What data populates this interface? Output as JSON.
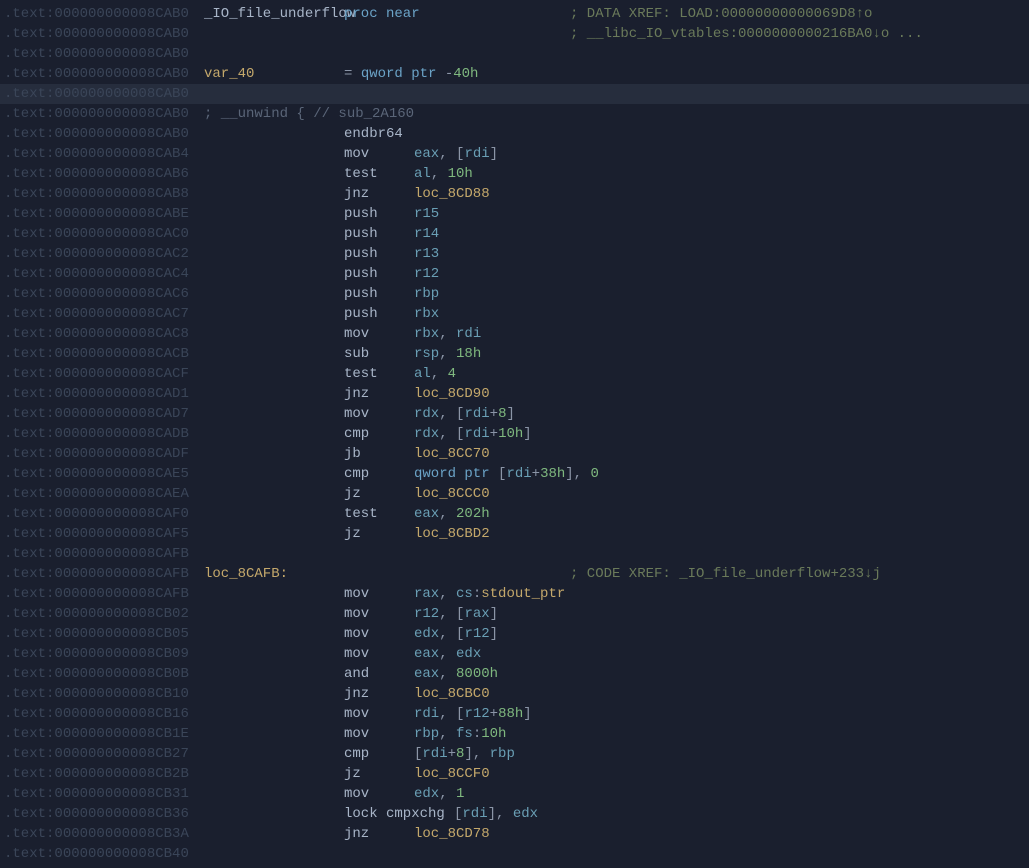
{
  "segment": ".text:",
  "lines": [
    {
      "addr": "000000000008CAB0",
      "label": "_IO_file_underflow",
      "label_class": "c-identifier",
      "directive": "proc near",
      "comment": "; DATA XREF: LOAD:00000000000069D8↑o",
      "comment_col": 570
    },
    {
      "addr": "000000000008CAB0",
      "comment": "; __libc_IO_vtables:0000000000216BA0↓o ...",
      "comment_col": 570
    },
    {
      "addr": "000000000008CAB0"
    },
    {
      "addr": "000000000008CAB0",
      "label": "var_40",
      "label_class": "c-loc",
      "var_eq": "= qword ptr -40h"
    },
    {
      "addr": "000000000008CAB0",
      "cursor": true
    },
    {
      "addr": "000000000008CAB0",
      "unwind": "; __unwind { // sub_2A160"
    },
    {
      "addr": "000000000008CAB0",
      "mnem": "endbr64"
    },
    {
      "addr": "000000000008CAB4",
      "mnem": "mov",
      "ops": [
        {
          "t": "eax",
          "c": "c-reg"
        },
        {
          "t": ", ",
          "c": "c-op"
        },
        {
          "t": "[",
          "c": "c-op"
        },
        {
          "t": "rdi",
          "c": "c-reg"
        },
        {
          "t": "]",
          "c": "c-op"
        }
      ]
    },
    {
      "addr": "000000000008CAB6",
      "mnem": "test",
      "ops": [
        {
          "t": "al",
          "c": "c-reg"
        },
        {
          "t": ", ",
          "c": "c-op"
        },
        {
          "t": "10h",
          "c": "c-num"
        }
      ]
    },
    {
      "addr": "000000000008CAB8",
      "mnem": "jnz",
      "ops": [
        {
          "t": "loc_8CD88",
          "c": "c-loc"
        }
      ]
    },
    {
      "addr": "000000000008CABE",
      "mnem": "push",
      "ops": [
        {
          "t": "r15",
          "c": "c-reg"
        }
      ]
    },
    {
      "addr": "000000000008CAC0",
      "mnem": "push",
      "ops": [
        {
          "t": "r14",
          "c": "c-reg"
        }
      ]
    },
    {
      "addr": "000000000008CAC2",
      "mnem": "push",
      "ops": [
        {
          "t": "r13",
          "c": "c-reg"
        }
      ]
    },
    {
      "addr": "000000000008CAC4",
      "mnem": "push",
      "ops": [
        {
          "t": "r12",
          "c": "c-reg"
        }
      ]
    },
    {
      "addr": "000000000008CAC6",
      "mnem": "push",
      "ops": [
        {
          "t": "rbp",
          "c": "c-reg"
        }
      ]
    },
    {
      "addr": "000000000008CAC7",
      "mnem": "push",
      "ops": [
        {
          "t": "rbx",
          "c": "c-reg"
        }
      ]
    },
    {
      "addr": "000000000008CAC8",
      "mnem": "mov",
      "ops": [
        {
          "t": "rbx",
          "c": "c-reg"
        },
        {
          "t": ", ",
          "c": "c-op"
        },
        {
          "t": "rdi",
          "c": "c-reg"
        }
      ]
    },
    {
      "addr": "000000000008CACB",
      "mnem": "sub",
      "ops": [
        {
          "t": "rsp",
          "c": "c-reg"
        },
        {
          "t": ", ",
          "c": "c-op"
        },
        {
          "t": "18h",
          "c": "c-num"
        }
      ]
    },
    {
      "addr": "000000000008CACF",
      "mnem": "test",
      "ops": [
        {
          "t": "al",
          "c": "c-reg"
        },
        {
          "t": ", ",
          "c": "c-op"
        },
        {
          "t": "4",
          "c": "c-num"
        }
      ]
    },
    {
      "addr": "000000000008CAD1",
      "mnem": "jnz",
      "ops": [
        {
          "t": "loc_8CD90",
          "c": "c-loc"
        }
      ]
    },
    {
      "addr": "000000000008CAD7",
      "mnem": "mov",
      "ops": [
        {
          "t": "rdx",
          "c": "c-reg"
        },
        {
          "t": ", ",
          "c": "c-op"
        },
        {
          "t": "[",
          "c": "c-op"
        },
        {
          "t": "rdi",
          "c": "c-reg"
        },
        {
          "t": "+",
          "c": "c-op"
        },
        {
          "t": "8",
          "c": "c-num"
        },
        {
          "t": "]",
          "c": "c-op"
        }
      ]
    },
    {
      "addr": "000000000008CADB",
      "mnem": "cmp",
      "ops": [
        {
          "t": "rdx",
          "c": "c-reg"
        },
        {
          "t": ", ",
          "c": "c-op"
        },
        {
          "t": "[",
          "c": "c-op"
        },
        {
          "t": "rdi",
          "c": "c-reg"
        },
        {
          "t": "+",
          "c": "c-op"
        },
        {
          "t": "10h",
          "c": "c-num"
        },
        {
          "t": "]",
          "c": "c-op"
        }
      ]
    },
    {
      "addr": "000000000008CADF",
      "mnem": "jb",
      "ops": [
        {
          "t": "loc_8CC70",
          "c": "c-loc"
        }
      ]
    },
    {
      "addr": "000000000008CAE5",
      "mnem": "cmp",
      "ops": [
        {
          "t": "qword ptr",
          "c": "c-type"
        },
        {
          "t": " [",
          "c": "c-op"
        },
        {
          "t": "rdi",
          "c": "c-reg"
        },
        {
          "t": "+",
          "c": "c-op"
        },
        {
          "t": "38h",
          "c": "c-num"
        },
        {
          "t": "], ",
          "c": "c-op"
        },
        {
          "t": "0",
          "c": "c-num"
        }
      ]
    },
    {
      "addr": "000000000008CAEA",
      "mnem": "jz",
      "ops": [
        {
          "t": "loc_8CCC0",
          "c": "c-loc"
        }
      ]
    },
    {
      "addr": "000000000008CAF0",
      "mnem": "test",
      "ops": [
        {
          "t": "eax",
          "c": "c-reg"
        },
        {
          "t": ", ",
          "c": "c-op"
        },
        {
          "t": "202h",
          "c": "c-num"
        }
      ]
    },
    {
      "addr": "000000000008CAF5",
      "mnem": "jz",
      "ops": [
        {
          "t": "loc_8CBD2",
          "c": "c-loc"
        }
      ]
    },
    {
      "addr": "000000000008CAFB"
    },
    {
      "addr": "000000000008CAFB",
      "label": "loc_8CAFB:",
      "label_class": "c-loc",
      "comment": "; CODE XREF: _IO_file_underflow+233↓j",
      "comment_col": 570
    },
    {
      "addr": "000000000008CAFB",
      "mnem": "mov",
      "ops": [
        {
          "t": "rax",
          "c": "c-reg"
        },
        {
          "t": ", ",
          "c": "c-op"
        },
        {
          "t": "cs",
          "c": "c-reg"
        },
        {
          "t": ":",
          "c": "c-op"
        },
        {
          "t": "stdout_ptr",
          "c": "c-global"
        }
      ]
    },
    {
      "addr": "000000000008CB02",
      "mnem": "mov",
      "ops": [
        {
          "t": "r12",
          "c": "c-reg"
        },
        {
          "t": ", ",
          "c": "c-op"
        },
        {
          "t": "[",
          "c": "c-op"
        },
        {
          "t": "rax",
          "c": "c-reg"
        },
        {
          "t": "]",
          "c": "c-op"
        }
      ]
    },
    {
      "addr": "000000000008CB05",
      "mnem": "mov",
      "ops": [
        {
          "t": "edx",
          "c": "c-reg"
        },
        {
          "t": ", ",
          "c": "c-op"
        },
        {
          "t": "[",
          "c": "c-op"
        },
        {
          "t": "r12",
          "c": "c-reg"
        },
        {
          "t": "]",
          "c": "c-op"
        }
      ]
    },
    {
      "addr": "000000000008CB09",
      "mnem": "mov",
      "ops": [
        {
          "t": "eax",
          "c": "c-reg"
        },
        {
          "t": ", ",
          "c": "c-op"
        },
        {
          "t": "edx",
          "c": "c-reg"
        }
      ]
    },
    {
      "addr": "000000000008CB0B",
      "mnem": "and",
      "ops": [
        {
          "t": "eax",
          "c": "c-reg"
        },
        {
          "t": ", ",
          "c": "c-op"
        },
        {
          "t": "8000h",
          "c": "c-num"
        }
      ]
    },
    {
      "addr": "000000000008CB10",
      "mnem": "jnz",
      "ops": [
        {
          "t": "loc_8CBC0",
          "c": "c-loc"
        }
      ]
    },
    {
      "addr": "000000000008CB16",
      "mnem": "mov",
      "ops": [
        {
          "t": "rdi",
          "c": "c-reg"
        },
        {
          "t": ", ",
          "c": "c-op"
        },
        {
          "t": "[",
          "c": "c-op"
        },
        {
          "t": "r12",
          "c": "c-reg"
        },
        {
          "t": "+",
          "c": "c-op"
        },
        {
          "t": "88h",
          "c": "c-num"
        },
        {
          "t": "]",
          "c": "c-op"
        }
      ]
    },
    {
      "addr": "000000000008CB1E",
      "mnem": "mov",
      "ops": [
        {
          "t": "rbp",
          "c": "c-reg"
        },
        {
          "t": ", ",
          "c": "c-op"
        },
        {
          "t": "fs",
          "c": "c-reg"
        },
        {
          "t": ":",
          "c": "c-op"
        },
        {
          "t": "10h",
          "c": "c-num"
        }
      ]
    },
    {
      "addr": "000000000008CB27",
      "mnem": "cmp",
      "ops": [
        {
          "t": "[",
          "c": "c-op"
        },
        {
          "t": "rdi",
          "c": "c-reg"
        },
        {
          "t": "+",
          "c": "c-op"
        },
        {
          "t": "8",
          "c": "c-num"
        },
        {
          "t": "], ",
          "c": "c-op"
        },
        {
          "t": "rbp",
          "c": "c-reg"
        }
      ]
    },
    {
      "addr": "000000000008CB2B",
      "mnem": "jz",
      "ops": [
        {
          "t": "loc_8CCF0",
          "c": "c-loc"
        }
      ]
    },
    {
      "addr": "000000000008CB31",
      "mnem": "mov",
      "ops": [
        {
          "t": "edx",
          "c": "c-reg"
        },
        {
          "t": ", ",
          "c": "c-op"
        },
        {
          "t": "1",
          "c": "c-num"
        }
      ]
    },
    {
      "addr": "000000000008CB36",
      "mnem": "lock cmpxchg",
      "mnem_wide": true,
      "ops": [
        {
          "t": "[",
          "c": "c-op"
        },
        {
          "t": "rdi",
          "c": "c-reg"
        },
        {
          "t": "], ",
          "c": "c-op"
        },
        {
          "t": "edx",
          "c": "c-reg"
        }
      ]
    },
    {
      "addr": "000000000008CB3A",
      "mnem": "jnz",
      "ops": [
        {
          "t": "loc_8CD78",
          "c": "c-loc"
        }
      ]
    },
    {
      "addr": "000000000008CB40"
    }
  ]
}
